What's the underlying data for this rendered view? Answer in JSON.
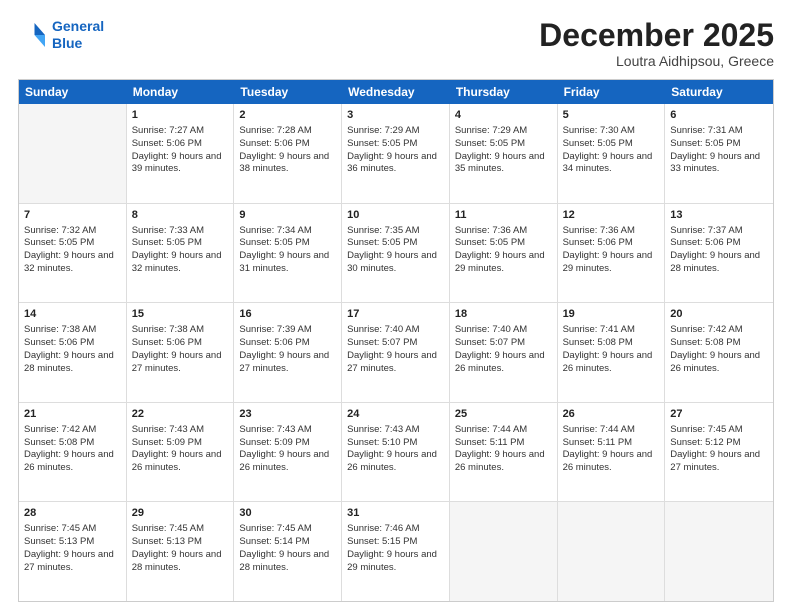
{
  "logo": {
    "line1": "General",
    "line2": "Blue"
  },
  "title": "December 2025",
  "location": "Loutra Aidhipsou, Greece",
  "header": {
    "days": [
      "Sunday",
      "Monday",
      "Tuesday",
      "Wednesday",
      "Thursday",
      "Friday",
      "Saturday"
    ]
  },
  "weeks": [
    [
      {
        "day": "",
        "sunrise": "",
        "sunset": "",
        "daylight": ""
      },
      {
        "day": "1",
        "sunrise": "Sunrise: 7:27 AM",
        "sunset": "Sunset: 5:06 PM",
        "daylight": "Daylight: 9 hours and 39 minutes."
      },
      {
        "day": "2",
        "sunrise": "Sunrise: 7:28 AM",
        "sunset": "Sunset: 5:06 PM",
        "daylight": "Daylight: 9 hours and 38 minutes."
      },
      {
        "day": "3",
        "sunrise": "Sunrise: 7:29 AM",
        "sunset": "Sunset: 5:05 PM",
        "daylight": "Daylight: 9 hours and 36 minutes."
      },
      {
        "day": "4",
        "sunrise": "Sunrise: 7:29 AM",
        "sunset": "Sunset: 5:05 PM",
        "daylight": "Daylight: 9 hours and 35 minutes."
      },
      {
        "day": "5",
        "sunrise": "Sunrise: 7:30 AM",
        "sunset": "Sunset: 5:05 PM",
        "daylight": "Daylight: 9 hours and 34 minutes."
      },
      {
        "day": "6",
        "sunrise": "Sunrise: 7:31 AM",
        "sunset": "Sunset: 5:05 PM",
        "daylight": "Daylight: 9 hours and 33 minutes."
      }
    ],
    [
      {
        "day": "7",
        "sunrise": "Sunrise: 7:32 AM",
        "sunset": "Sunset: 5:05 PM",
        "daylight": "Daylight: 9 hours and 32 minutes."
      },
      {
        "day": "8",
        "sunrise": "Sunrise: 7:33 AM",
        "sunset": "Sunset: 5:05 PM",
        "daylight": "Daylight: 9 hours and 32 minutes."
      },
      {
        "day": "9",
        "sunrise": "Sunrise: 7:34 AM",
        "sunset": "Sunset: 5:05 PM",
        "daylight": "Daylight: 9 hours and 31 minutes."
      },
      {
        "day": "10",
        "sunrise": "Sunrise: 7:35 AM",
        "sunset": "Sunset: 5:05 PM",
        "daylight": "Daylight: 9 hours and 30 minutes."
      },
      {
        "day": "11",
        "sunrise": "Sunrise: 7:36 AM",
        "sunset": "Sunset: 5:05 PM",
        "daylight": "Daylight: 9 hours and 29 minutes."
      },
      {
        "day": "12",
        "sunrise": "Sunrise: 7:36 AM",
        "sunset": "Sunset: 5:06 PM",
        "daylight": "Daylight: 9 hours and 29 minutes."
      },
      {
        "day": "13",
        "sunrise": "Sunrise: 7:37 AM",
        "sunset": "Sunset: 5:06 PM",
        "daylight": "Daylight: 9 hours and 28 minutes."
      }
    ],
    [
      {
        "day": "14",
        "sunrise": "Sunrise: 7:38 AM",
        "sunset": "Sunset: 5:06 PM",
        "daylight": "Daylight: 9 hours and 28 minutes."
      },
      {
        "day": "15",
        "sunrise": "Sunrise: 7:38 AM",
        "sunset": "Sunset: 5:06 PM",
        "daylight": "Daylight: 9 hours and 27 minutes."
      },
      {
        "day": "16",
        "sunrise": "Sunrise: 7:39 AM",
        "sunset": "Sunset: 5:06 PM",
        "daylight": "Daylight: 9 hours and 27 minutes."
      },
      {
        "day": "17",
        "sunrise": "Sunrise: 7:40 AM",
        "sunset": "Sunset: 5:07 PM",
        "daylight": "Daylight: 9 hours and 27 minutes."
      },
      {
        "day": "18",
        "sunrise": "Sunrise: 7:40 AM",
        "sunset": "Sunset: 5:07 PM",
        "daylight": "Daylight: 9 hours and 26 minutes."
      },
      {
        "day": "19",
        "sunrise": "Sunrise: 7:41 AM",
        "sunset": "Sunset: 5:08 PM",
        "daylight": "Daylight: 9 hours and 26 minutes."
      },
      {
        "day": "20",
        "sunrise": "Sunrise: 7:42 AM",
        "sunset": "Sunset: 5:08 PM",
        "daylight": "Daylight: 9 hours and 26 minutes."
      }
    ],
    [
      {
        "day": "21",
        "sunrise": "Sunrise: 7:42 AM",
        "sunset": "Sunset: 5:08 PM",
        "daylight": "Daylight: 9 hours and 26 minutes."
      },
      {
        "day": "22",
        "sunrise": "Sunrise: 7:43 AM",
        "sunset": "Sunset: 5:09 PM",
        "daylight": "Daylight: 9 hours and 26 minutes."
      },
      {
        "day": "23",
        "sunrise": "Sunrise: 7:43 AM",
        "sunset": "Sunset: 5:09 PM",
        "daylight": "Daylight: 9 hours and 26 minutes."
      },
      {
        "day": "24",
        "sunrise": "Sunrise: 7:43 AM",
        "sunset": "Sunset: 5:10 PM",
        "daylight": "Daylight: 9 hours and 26 minutes."
      },
      {
        "day": "25",
        "sunrise": "Sunrise: 7:44 AM",
        "sunset": "Sunset: 5:11 PM",
        "daylight": "Daylight: 9 hours and 26 minutes."
      },
      {
        "day": "26",
        "sunrise": "Sunrise: 7:44 AM",
        "sunset": "Sunset: 5:11 PM",
        "daylight": "Daylight: 9 hours and 26 minutes."
      },
      {
        "day": "27",
        "sunrise": "Sunrise: 7:45 AM",
        "sunset": "Sunset: 5:12 PM",
        "daylight": "Daylight: 9 hours and 27 minutes."
      }
    ],
    [
      {
        "day": "28",
        "sunrise": "Sunrise: 7:45 AM",
        "sunset": "Sunset: 5:13 PM",
        "daylight": "Daylight: 9 hours and 27 minutes."
      },
      {
        "day": "29",
        "sunrise": "Sunrise: 7:45 AM",
        "sunset": "Sunset: 5:13 PM",
        "daylight": "Daylight: 9 hours and 28 minutes."
      },
      {
        "day": "30",
        "sunrise": "Sunrise: 7:45 AM",
        "sunset": "Sunset: 5:14 PM",
        "daylight": "Daylight: 9 hours and 28 minutes."
      },
      {
        "day": "31",
        "sunrise": "Sunrise: 7:46 AM",
        "sunset": "Sunset: 5:15 PM",
        "daylight": "Daylight: 9 hours and 29 minutes."
      },
      {
        "day": "",
        "sunrise": "",
        "sunset": "",
        "daylight": ""
      },
      {
        "day": "",
        "sunrise": "",
        "sunset": "",
        "daylight": ""
      },
      {
        "day": "",
        "sunrise": "",
        "sunset": "",
        "daylight": ""
      }
    ]
  ]
}
